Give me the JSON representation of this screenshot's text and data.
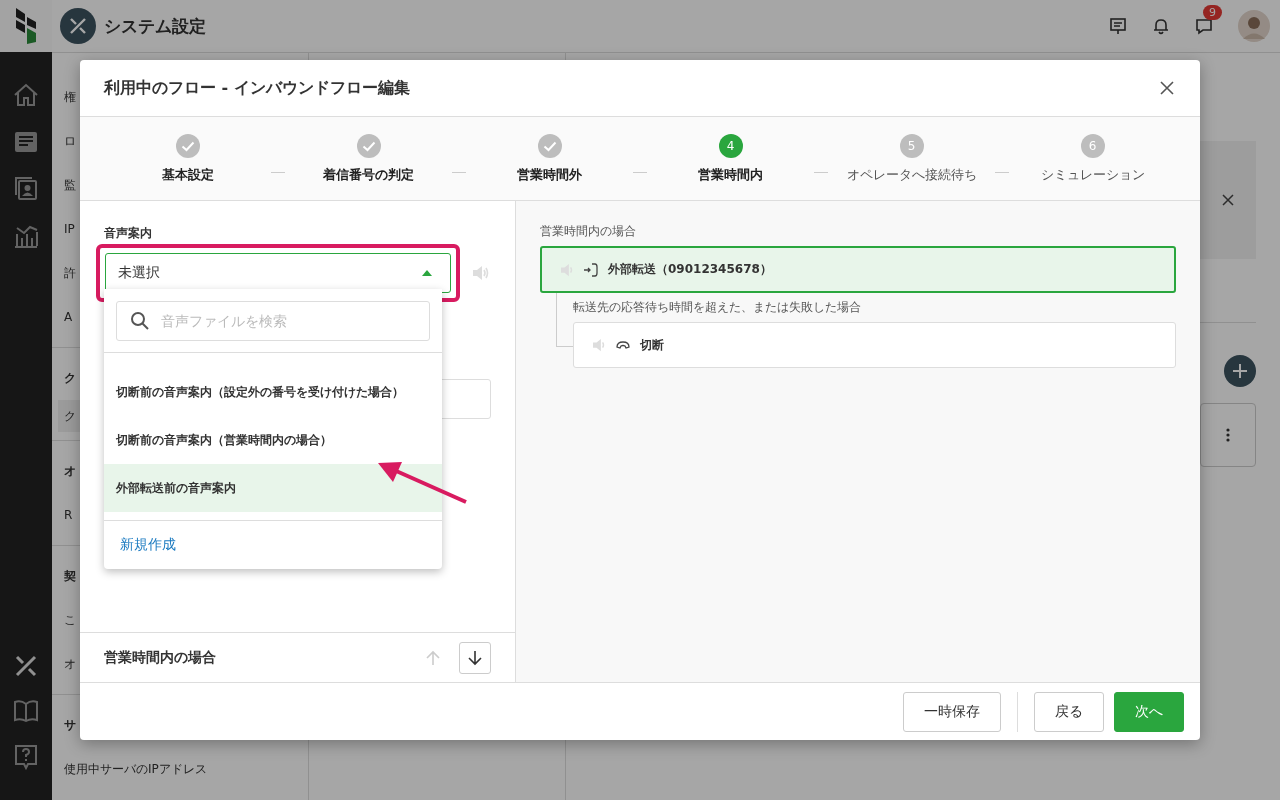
{
  "app": {
    "title": "システム設定"
  },
  "header": {
    "chat_badge": "9"
  },
  "background_sidebar": {
    "items": [
      {
        "label": "権",
        "kind": "item",
        "selected": false
      },
      {
        "label": "ロ",
        "kind": "item",
        "selected": false
      },
      {
        "label": "監",
        "kind": "item",
        "selected": false
      },
      {
        "label": "IP",
        "kind": "item",
        "selected": false
      },
      {
        "label": "許",
        "kind": "item",
        "selected": false
      },
      {
        "label": "A",
        "kind": "item",
        "selected": false
      },
      {
        "label": "ク",
        "kind": "heading",
        "selected": false
      },
      {
        "label": "ク",
        "kind": "item",
        "selected": true
      },
      {
        "label": "オ",
        "kind": "heading",
        "selected": false
      },
      {
        "label": "R",
        "kind": "item",
        "selected": false
      },
      {
        "label": "契",
        "kind": "heading",
        "selected": false
      },
      {
        "label": "こ",
        "kind": "item",
        "selected": false
      },
      {
        "label": "オ",
        "kind": "item",
        "selected": false
      },
      {
        "label": "サ",
        "kind": "heading",
        "selected": false
      },
      {
        "label": "使用中サーバのIPアドレス",
        "kind": "item",
        "selected": false
      }
    ]
  },
  "modal": {
    "title": "利用中のフロー - インバウンドフロー編集",
    "steps": [
      {
        "label": "基本設定",
        "completed": true,
        "selected": false
      },
      {
        "label": "着信番号の判定",
        "completed": true,
        "selected": false
      },
      {
        "label": "営業時間外",
        "completed": true,
        "selected": false
      },
      {
        "label": "営業時間内",
        "number": "4",
        "completed": false,
        "selected": true
      },
      {
        "label": "オペレータへ接続待ち",
        "number": "5",
        "completed": false,
        "selected": false
      },
      {
        "label": "シミュレーション",
        "number": "6",
        "completed": false,
        "selected": false
      }
    ],
    "left_panel": {
      "field_label": "音声案内",
      "select": {
        "value": "未選択",
        "expanded": true
      },
      "search": {
        "placeholder": "音声ファイルを検索"
      },
      "options": [
        {
          "label": "切断前の音声案内（設定外の番号を受け付けた場合）",
          "selected": false
        },
        {
          "label": "切断前の音声案内（営業時間内の場合）",
          "selected": false
        },
        {
          "label": "外部転送前の音声案内",
          "selected": true
        }
      ],
      "create_link": "新規作成",
      "section_title": "営業時間内の場合",
      "move_up": {
        "disabled": true
      },
      "move_down": {
        "disabled": false
      }
    },
    "right_panel": {
      "title": "営業時間内の場合",
      "nodes": [
        {
          "label": "外部転送（09012345678）",
          "kind": "transfer",
          "selected": true,
          "branch_label": "転送先の応答待ち時間を超えた、または失敗した場合",
          "children": [
            {
              "label": "切断",
              "kind": "hangup",
              "selected": false
            }
          ]
        }
      ]
    },
    "footer": {
      "save_button": "一時保存",
      "back_button": "戻る",
      "next_button": "次へ"
    }
  }
}
